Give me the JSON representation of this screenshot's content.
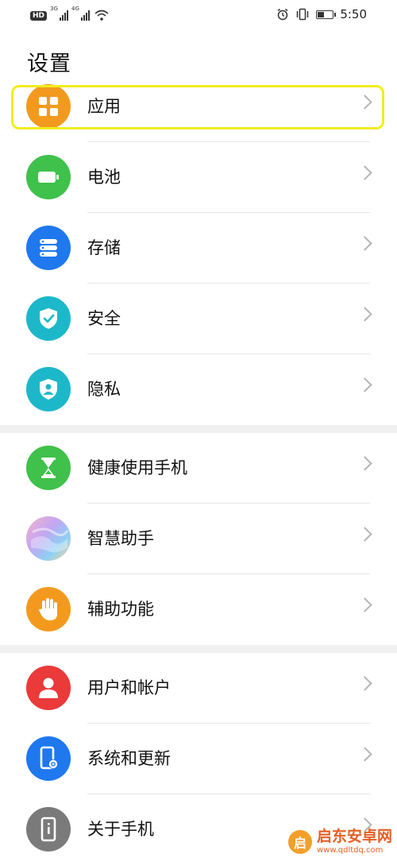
{
  "status_bar": {
    "hd": "HD",
    "net1": "3G",
    "net2": "4G",
    "time": "5:50",
    "battery_level": 0.45
  },
  "page_title": "设置",
  "highlighted_item": "应用",
  "colors": {
    "highlight": "#f2ec1e",
    "chevron": "#b5b5b5",
    "divider": "#e6e6e6",
    "section_gap": "#f0f0f0"
  },
  "sections": [
    {
      "items": [
        {
          "label": "应用",
          "icon": "apps-grid-icon",
          "color": "#f39a1e"
        },
        {
          "label": "电池",
          "icon": "battery-icon",
          "color": "#3fc14b"
        },
        {
          "label": "存储",
          "icon": "storage-icon",
          "color": "#1f78ee"
        },
        {
          "label": "安全",
          "icon": "shield-check-icon",
          "color": "#1cb8c9"
        },
        {
          "label": "隐私",
          "icon": "privacy-shield-icon",
          "color": "#1cb8c9"
        }
      ]
    },
    {
      "items": [
        {
          "label": "健康使用手机",
          "icon": "hourglass-icon",
          "color": "#3fc14b"
        },
        {
          "label": "智慧助手",
          "icon": "smart-assistant-icon",
          "color": "gradient"
        },
        {
          "label": "辅助功能",
          "icon": "hand-icon",
          "color": "#f39a1e"
        }
      ]
    },
    {
      "items": [
        {
          "label": "用户和帐户",
          "icon": "user-icon",
          "color": "#ea3a3a"
        },
        {
          "label": "系统和更新",
          "icon": "phone-gear-icon",
          "color": "#1f78ee"
        },
        {
          "label": "关于手机",
          "icon": "phone-info-icon",
          "color": "#7a7a7a"
        }
      ]
    }
  ],
  "watermark": {
    "title": "启东安卓网",
    "url": "www.qdltdq.com",
    "logo_char": "启"
  }
}
